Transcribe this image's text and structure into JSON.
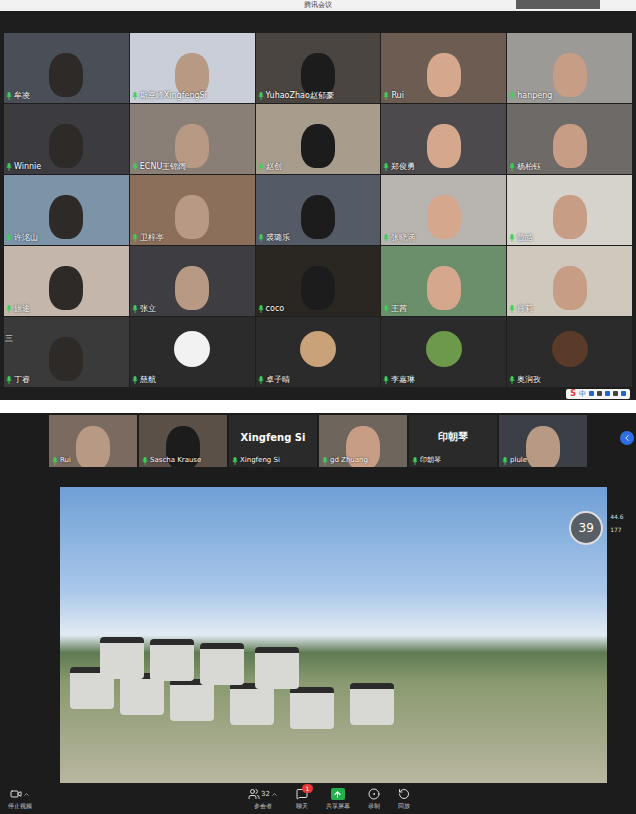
{
  "window": {
    "title": "腾讯会议"
  },
  "gallery": {
    "participants": [
      {
        "name": "牟凌",
        "kind": "video"
      },
      {
        "name": "斯幸峰XingfengSi",
        "kind": "video"
      },
      {
        "name": "YuhaoZhao赵郁豪",
        "kind": "video"
      },
      {
        "name": "Rui",
        "kind": "video"
      },
      {
        "name": "hanpeng",
        "kind": "video"
      },
      {
        "name": "Winnie",
        "kind": "video"
      },
      {
        "name": "ECNU王锦阔",
        "kind": "video"
      },
      {
        "name": "赵创",
        "kind": "video"
      },
      {
        "name": "郑俊勇",
        "kind": "video"
      },
      {
        "name": "杨柏钰",
        "kind": "video"
      },
      {
        "name": "许洺山",
        "kind": "video"
      },
      {
        "name": "卫梓亭",
        "kind": "video"
      },
      {
        "name": "裘璐乐",
        "kind": "video"
      },
      {
        "name": "张晓涵",
        "kind": "video"
      },
      {
        "name": "曾皓",
        "kind": "video"
      },
      {
        "name": "旅途",
        "kind": "video"
      },
      {
        "name": "张立",
        "kind": "video"
      },
      {
        "name": "coco",
        "kind": "video"
      },
      {
        "name": "王茜",
        "kind": "video"
      },
      {
        "name": "肖莉",
        "kind": "video"
      },
      {
        "name": "丁睿",
        "kind": "video",
        "corner": "三"
      },
      {
        "name": "慈航",
        "kind": "avatar"
      },
      {
        "name": "卓子晴",
        "kind": "avatar"
      },
      {
        "name": "李嘉琳",
        "kind": "avatar"
      },
      {
        "name": "奥润孜",
        "kind": "avatar"
      }
    ]
  },
  "ime": {
    "logo": "S",
    "mode": "中"
  },
  "share": {
    "thumbnails": [
      {
        "name": "Rui",
        "kind": "video"
      },
      {
        "name": "Sascha Krause",
        "kind": "video"
      },
      {
        "name": "Xingfeng Si",
        "kind": "name-only"
      },
      {
        "name": "gd Zhuang",
        "kind": "video"
      },
      {
        "name": "印朝琴",
        "kind": "name-only"
      },
      {
        "name": "plule",
        "kind": "video"
      }
    ],
    "timer": "39",
    "readings": [
      "44.6",
      "177"
    ],
    "toolbar": [
      {
        "label": "停止视频",
        "count": "",
        "badge": "",
        "selected": false
      },
      {
        "label": "参会者",
        "count": "32",
        "badge": "",
        "selected": false
      },
      {
        "label": "聊天",
        "count": "",
        "badge": "1",
        "selected": false
      },
      {
        "label": "共享屏幕",
        "count": "",
        "badge": "",
        "selected": true
      },
      {
        "label": "录制",
        "count": "",
        "badge": "",
        "selected": false
      },
      {
        "label": "回放",
        "count": "",
        "badge": "",
        "selected": false
      }
    ]
  }
}
